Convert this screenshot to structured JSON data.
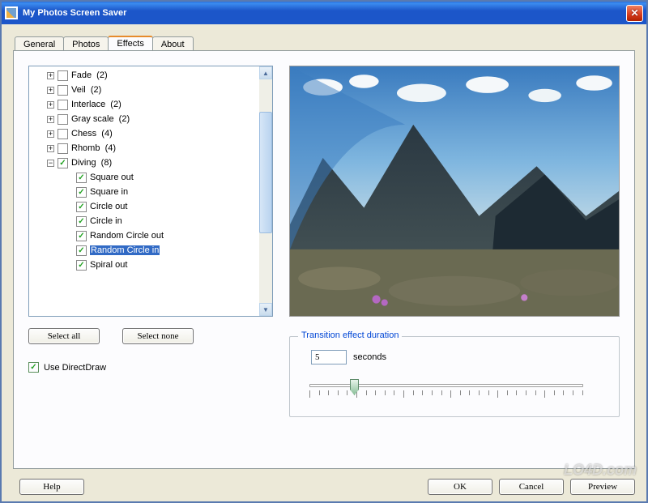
{
  "window": {
    "title": "My Photos Screen Saver",
    "close_label": "X"
  },
  "tabs": {
    "general": "General",
    "photos": "Photos",
    "effects": "Effects",
    "about": "About",
    "active": "Effects"
  },
  "effects_tree": {
    "groups": [
      {
        "label": "Fade",
        "count": 2,
        "expanded": false,
        "checked": false
      },
      {
        "label": "Veil",
        "count": 2,
        "expanded": false,
        "checked": false
      },
      {
        "label": "Interlace",
        "count": 2,
        "expanded": false,
        "checked": false
      },
      {
        "label": "Gray scale",
        "count": 2,
        "expanded": false,
        "checked": false
      },
      {
        "label": "Chess",
        "count": 4,
        "expanded": false,
        "checked": false
      },
      {
        "label": "Rhomb",
        "count": 4,
        "expanded": false,
        "checked": false
      },
      {
        "label": "Diving",
        "count": 8,
        "expanded": true,
        "checked": true,
        "children": [
          {
            "label": "Square out",
            "checked": true
          },
          {
            "label": "Square in",
            "checked": true
          },
          {
            "label": "Circle out",
            "checked": true
          },
          {
            "label": "Circle in",
            "checked": true
          },
          {
            "label": "Random Circle out",
            "checked": true
          },
          {
            "label": "Random Circle in",
            "checked": true,
            "selected": true
          },
          {
            "label": "Spiral out",
            "checked": true
          }
        ]
      }
    ]
  },
  "buttons": {
    "select_all": "Select all",
    "select_none": "Select none",
    "help": "Help",
    "ok": "OK",
    "cancel": "Cancel",
    "preview": "Preview"
  },
  "options": {
    "use_directdraw": "Use DirectDraw",
    "use_directdraw_checked": true
  },
  "duration": {
    "group_title": "Transition effect duration",
    "value": "5",
    "unit": "seconds",
    "slider": {
      "min": 1,
      "max": 30,
      "value": 5
    }
  },
  "watermark": "LO4D.com"
}
